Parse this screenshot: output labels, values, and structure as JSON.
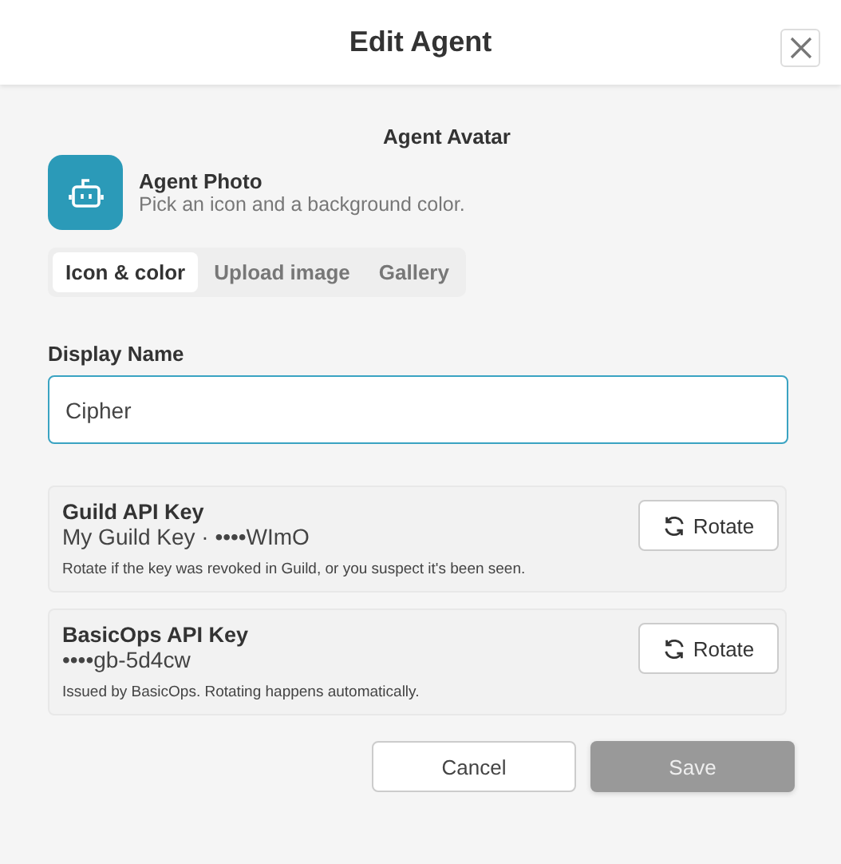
{
  "dialog": {
    "title": "Edit Agent"
  },
  "avatar": {
    "heading": "Agent Avatar",
    "title": "Agent Photo",
    "hint": "Pick an icon and a background color."
  },
  "tabs": [
    {
      "label": "Icon & color",
      "selected": true
    },
    {
      "label": "Upload image",
      "selected": false
    },
    {
      "label": "Gallery",
      "selected": false
    }
  ],
  "display_name": {
    "label": "Display Name",
    "value": "Cipher"
  },
  "keys": [
    {
      "title": "Guild API Key",
      "value": "My Guild Key · ••••WImO",
      "note": "Rotate if the key was revoked in Guild, or you suspect it's been seen.",
      "button": "Rotate"
    },
    {
      "title": "BasicOps API Key",
      "value": "••••gb-5d4cw",
      "note": "Issued by BasicOps. Rotating happens automatically.",
      "button": "Rotate"
    }
  ],
  "buttons": [
    {
      "label": "Cancel",
      "kind": "secondary",
      "disabled": false
    },
    {
      "label": "Save",
      "kind": "primary",
      "disabled": true
    }
  ]
}
